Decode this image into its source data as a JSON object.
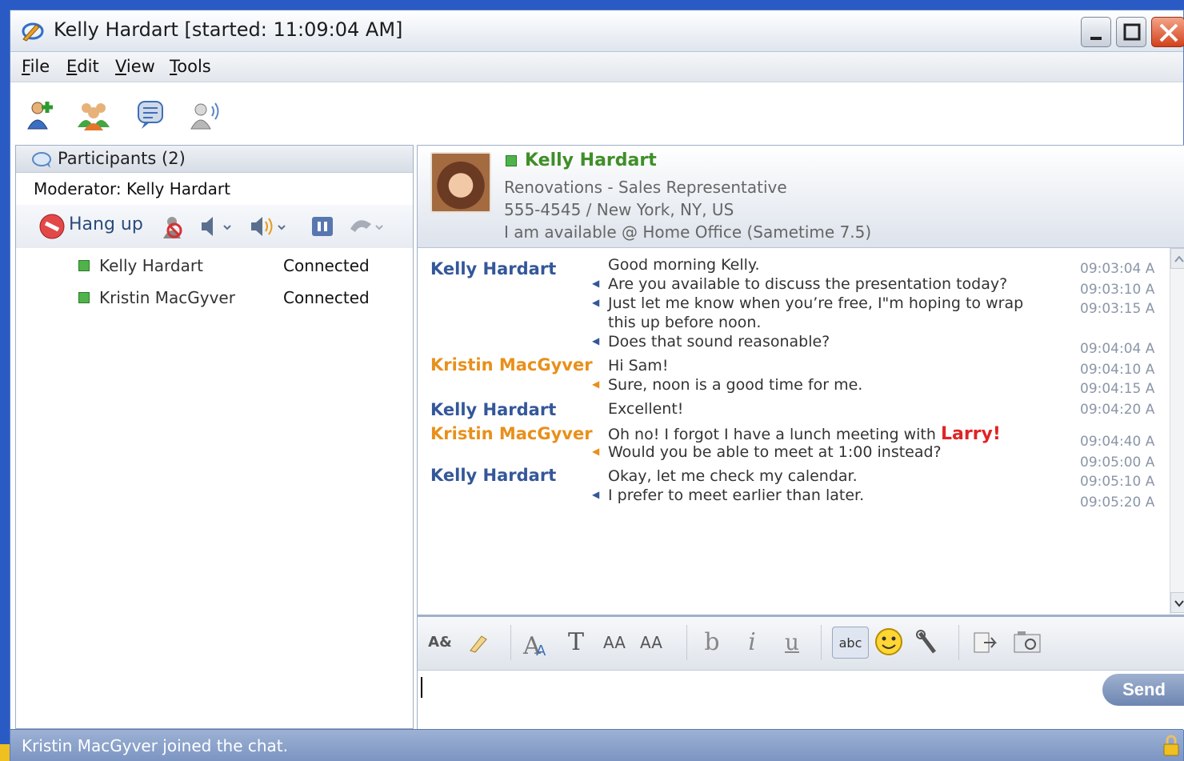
{
  "window": {
    "title": "Kelly Hardart [started: 11:09:04 AM]"
  },
  "menu": {
    "items": [
      {
        "first": "F",
        "rest": "ile"
      },
      {
        "first": "E",
        "rest": "dit"
      },
      {
        "first": "V",
        "rest": "iew"
      },
      {
        "first": "T",
        "rest": "ools"
      }
    ]
  },
  "toolbar": {
    "icons": [
      "add-person-icon",
      "group-icon",
      "chat-bubble-icon",
      "voice-call-icon"
    ]
  },
  "participants_pane": {
    "header": "Participants (2)",
    "moderator_label": "Moderator: Kelly Hardart",
    "hangup_label": "Hang up",
    "participants": [
      {
        "name": "Kelly Hardart",
        "status": "Connected"
      },
      {
        "name": "Kristin MacGyver",
        "status": "Connected"
      }
    ]
  },
  "contact": {
    "name": "Kelly Hardart",
    "title": "Renovations - Sales Representative",
    "phone_location": "555-4545 / New York, NY, US",
    "status": "I am available @ Home Office (Sametime 7.5)",
    "status_color": "#4fb34a"
  },
  "transcript": {
    "senders": [
      "Kelly Hardart",
      "Kristin MacGyver",
      "Kelly Hardart",
      "Kristin MacGyver",
      "Kelly Hardart"
    ],
    "messages": [
      "Good morning Kelly.",
      "Are you available to discuss the presentation today?",
      "Just let me know when you’re free, I\"m hoping to wrap",
      "this up before noon.",
      "Does that sound reasonable?",
      "Hi Sam!",
      "Sure, noon is a good time for me.",
      "Excellent!",
      "Oh no! I forgot I have a lunch meeting with",
      "Larry!",
      "Would you be able to meet at 1:00 instead?",
      "Okay, let me check my calendar.",
      "I prefer to meet earlier than later."
    ],
    "timestamps": [
      "09:03:04 A",
      "09:03:10 A",
      "09:03:15 A",
      "09:04:04 A",
      "09:04:10 A",
      "09:04:15 A",
      "09:04:20 A",
      "09:04:40 A",
      "09:05:00 A",
      "09:05:10 A",
      "09:05:20 A"
    ]
  },
  "format_bar": {
    "items": [
      "A&",
      "T",
      "AA",
      "AA",
      "b",
      "i",
      "u",
      "abc"
    ]
  },
  "compose": {
    "send_label": "Send",
    "value": ""
  },
  "statusbar": {
    "text": "Kristin MacGyver joined the chat."
  },
  "colors": {
    "kelly": "#34579a",
    "kristin": "#e8901a",
    "highlight": "#e02424"
  }
}
